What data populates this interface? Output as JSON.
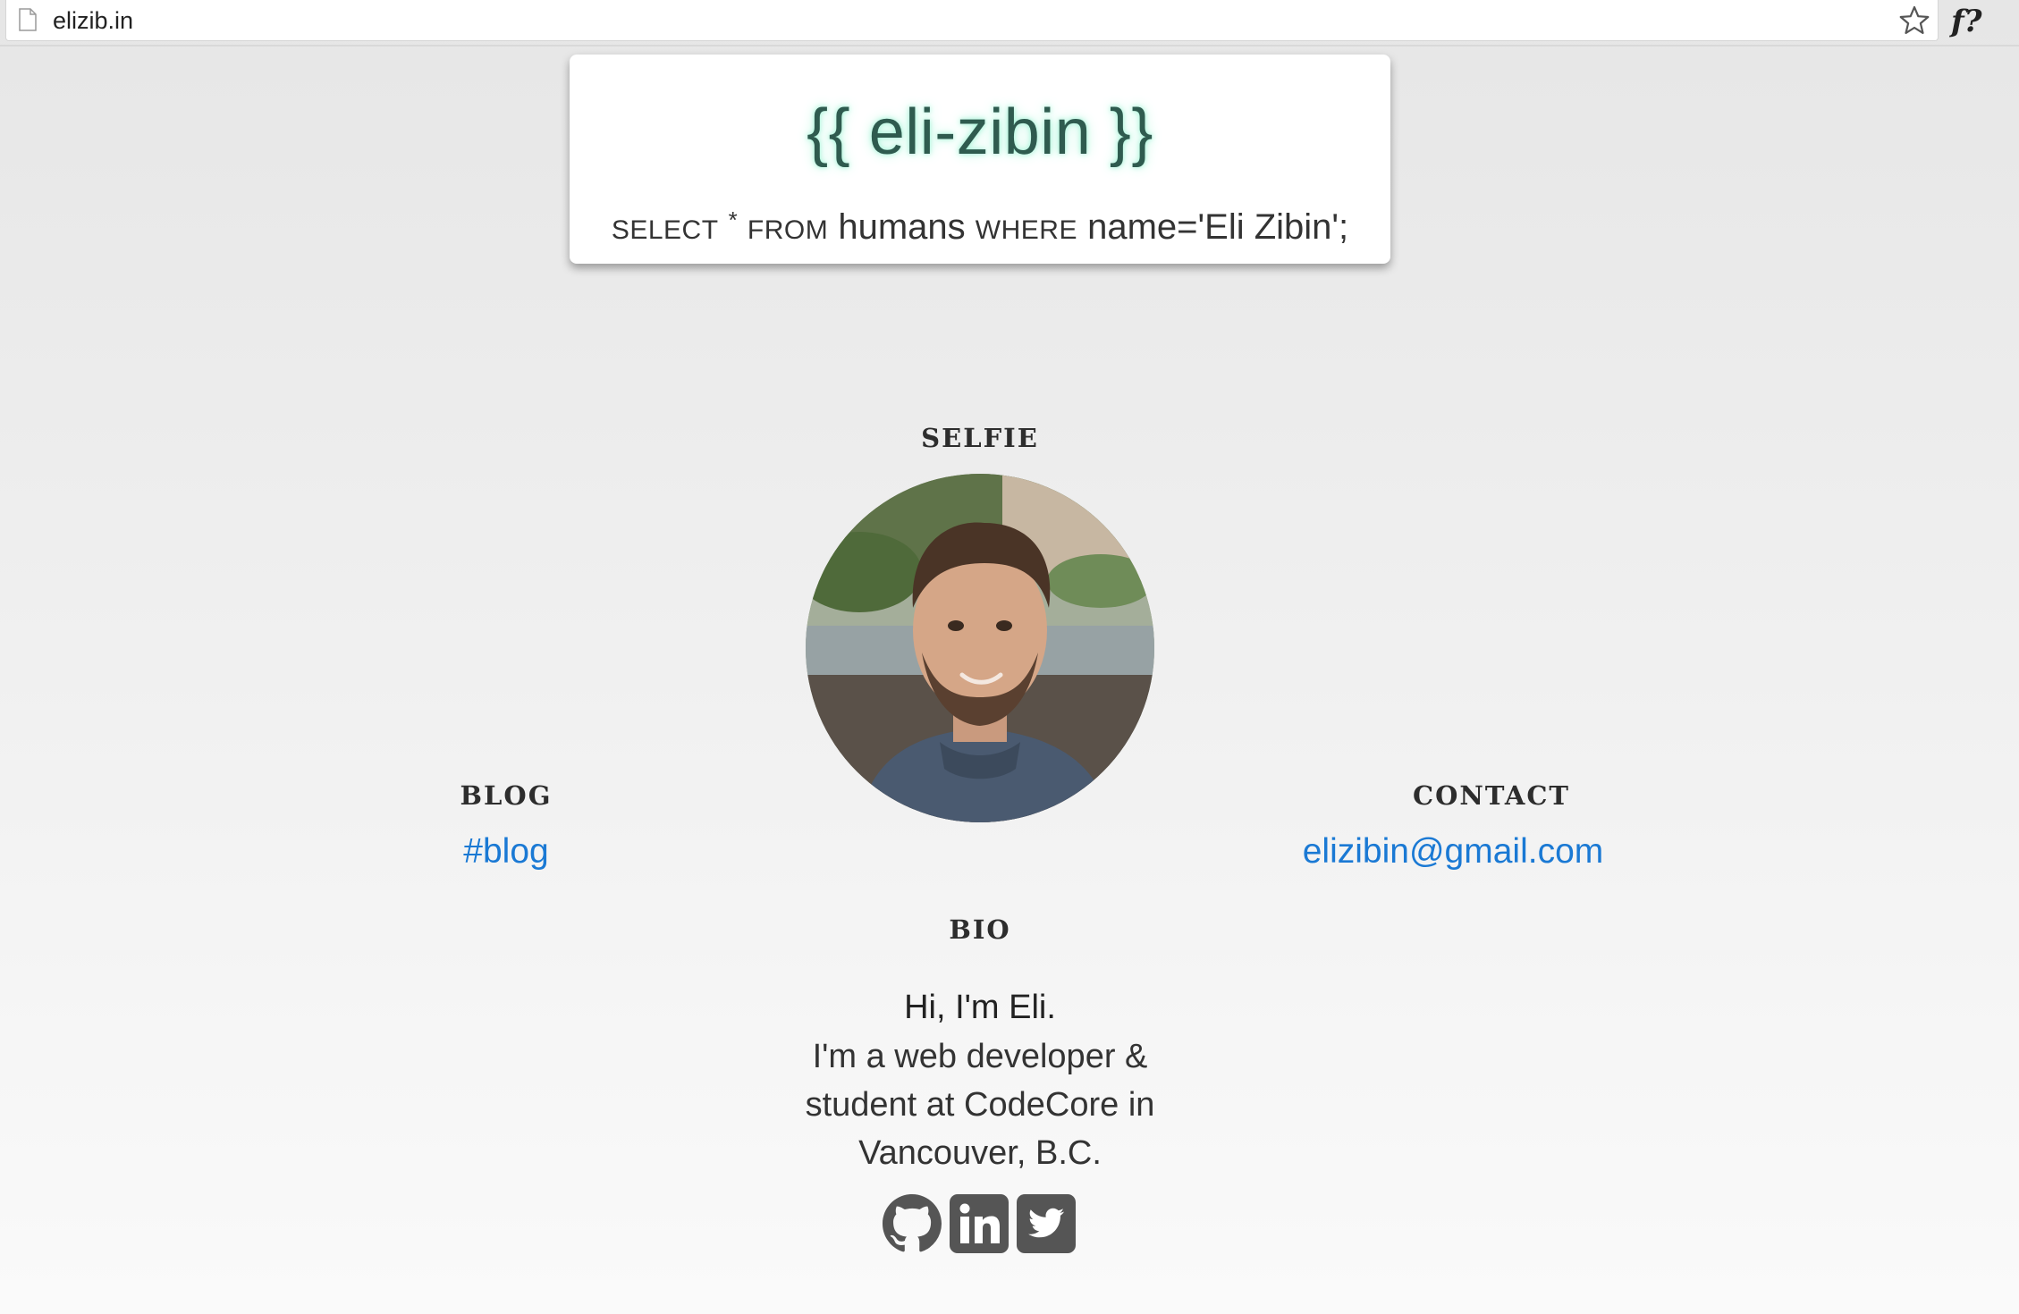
{
  "browser": {
    "url": "elizib.in",
    "page_icon": "page-icon",
    "bookmark_icon": "star-icon",
    "extension_label": "f?"
  },
  "header": {
    "title": "{{ eli-zibin }}",
    "sql": {
      "select": "SELECT",
      "star": "*",
      "from": "FROM",
      "table": "humans",
      "where": "WHERE",
      "condition": "name='Eli Zibin';"
    }
  },
  "selfie": {
    "heading": "SELFIE",
    "image_icon": "portrait-photo"
  },
  "blog": {
    "heading": "BLOG",
    "link": "#blog"
  },
  "contact": {
    "heading": "CONTACT",
    "email": "elizibin@gmail.com"
  },
  "bio": {
    "heading": "BIO",
    "greeting": "Hi, I'm Eli.",
    "lines": [
      "I'm a web developer &",
      "student at CodeCore in",
      "Vancouver, B.C."
    ]
  },
  "social": [
    {
      "icon": "github-icon"
    },
    {
      "icon": "linkedin-icon"
    },
    {
      "icon": "twitter-icon"
    }
  ],
  "colors": {
    "link": "#1a79d4",
    "title_glow": "#9ef3d4",
    "icon": "#555555"
  }
}
